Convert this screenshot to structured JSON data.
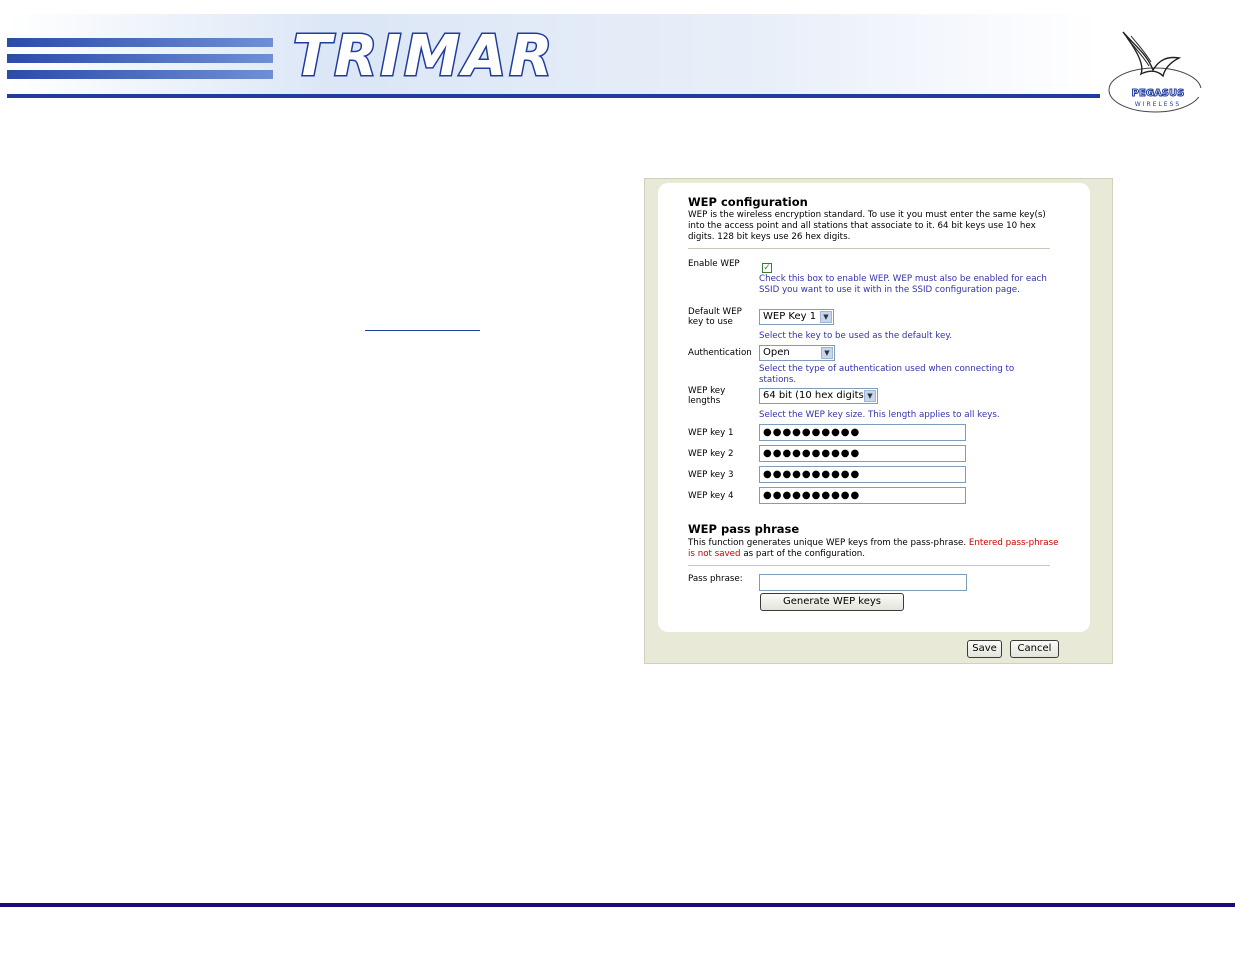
{
  "brand": {
    "name": "TRIMAR",
    "partner_logo": "PEGASUS WIRELESS"
  },
  "wep": {
    "title": "WEP configuration",
    "description": "WEP is the wireless encryption standard. To use it you must enter the same key(s) into the access point and all stations that associate to it. 64 bit keys use 10 hex digits. 128 bit keys use 26 hex digits.",
    "enable_label": "Enable WEP",
    "enable_checked": true,
    "enable_hint": "Check this box to enable WEP. WEP must also be enabled for each SSID you want to use it with in the SSID configuration page.",
    "default_key_label": "Default WEP key to use",
    "default_key_value": "WEP Key 1",
    "default_key_hint": "Select the key to be used as the default key.",
    "auth_label": "Authentication",
    "auth_value": "Open",
    "auth_hint": "Select the type of authentication used when connecting to stations.",
    "length_label": "WEP key lengths",
    "length_value": "64 bit (10 hex digits)",
    "length_hint": "Select the WEP key size. This length applies to all keys.",
    "keys": [
      {
        "label": "WEP key 1",
        "value": "●●●●●●●●●●"
      },
      {
        "label": "WEP key 2",
        "value": "●●●●●●●●●●"
      },
      {
        "label": "WEP key 3",
        "value": "●●●●●●●●●●"
      },
      {
        "label": "WEP key 4",
        "value": "●●●●●●●●●●"
      }
    ]
  },
  "pass": {
    "title": "WEP pass phrase",
    "desc_part1": "This function generates unique WEP keys from the pass-phrase.",
    "desc_part2": "Entered pass-phrase is not saved",
    "desc_part3": "as part of the configuration.",
    "label": "Pass phrase:",
    "value": "",
    "generate_label": "Generate WEP keys"
  },
  "actions": {
    "save_label": "Save",
    "cancel_label": "Cancel"
  },
  "colors": {
    "brand_blue": "#1f3c9e",
    "hint_blue": "#3333aa",
    "warning_red": "#cc0000",
    "panel_bg": "#e8e9d6"
  }
}
